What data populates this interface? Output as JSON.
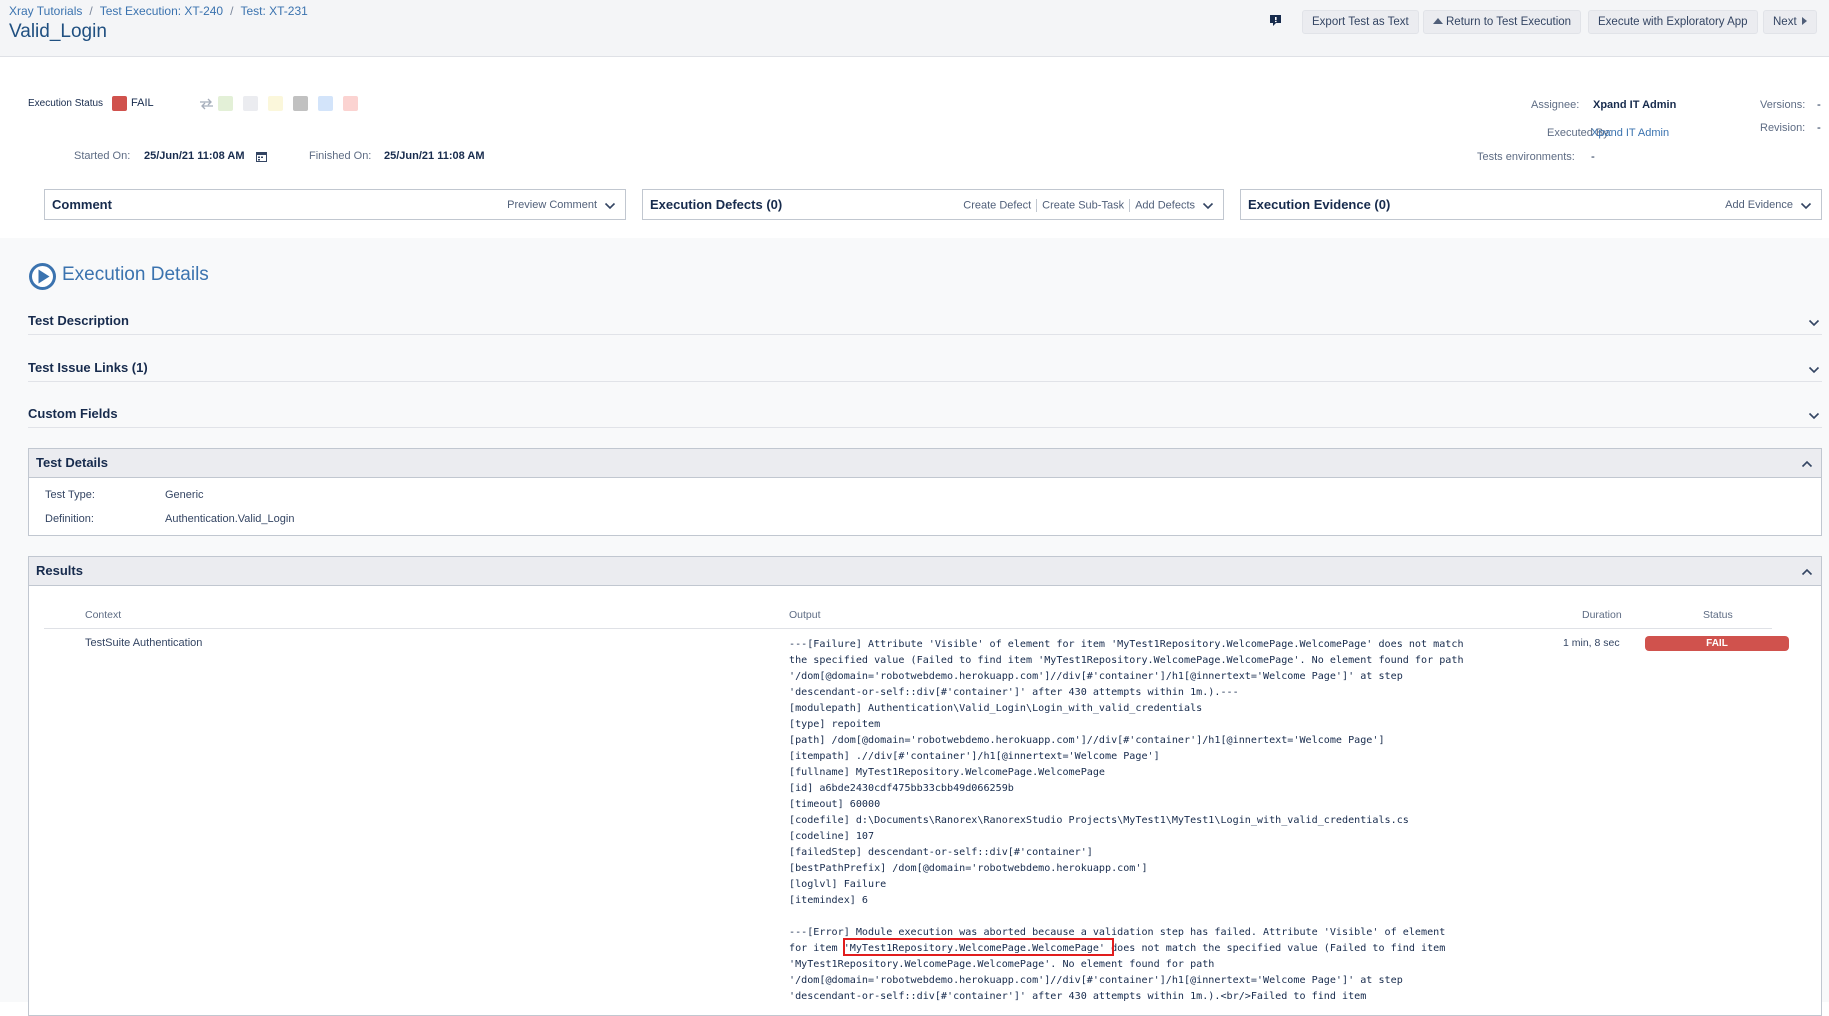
{
  "breadcrumbs": [
    "Xray Tutorials",
    "Test Execution: XT-240",
    "Test: XT-231"
  ],
  "page_title": "Valid_Login",
  "toolbar": {
    "feedback_icon": "feedback-icon",
    "export_label": "Export Test as Text",
    "return_label": "Return to Test Execution",
    "exploratory_label": "Execute with Exploratory App",
    "next_label": "Next"
  },
  "status": {
    "label": "Execution Status",
    "value": "FAIL",
    "color": "#d0524d",
    "swatch_colors": [
      "#e3f0d7",
      "#ebecf0",
      "#fbf7db",
      "#c1c1c1",
      "#d3e4fa",
      "#fbd3d1"
    ]
  },
  "dates": {
    "started_label": "Started On:",
    "started_value": "25/Jun/21 11:08 AM",
    "finished_label": "Finished On:",
    "finished_value": "25/Jun/21 11:08 AM"
  },
  "people": {
    "assignee_label": "Assignee:",
    "assignee_value": "Xpand IT Admin",
    "executed_label": "Executed By:",
    "executed_value": "Xpand IT Admin",
    "envs_label": "Tests environments:",
    "envs_value": "-",
    "versions_label": "Versions:",
    "versions_value": "-",
    "revision_label": "Revision:",
    "revision_value": "-"
  },
  "panels": {
    "comment": {
      "title": "Comment",
      "action": "Preview Comment"
    },
    "defects": {
      "title": "Execution Defects (0)",
      "actions": [
        "Create Defect",
        "Create Sub-Task",
        "Add Defects"
      ]
    },
    "evidence": {
      "title": "Execution Evidence (0)",
      "action": "Add Evidence"
    }
  },
  "execution_details": {
    "title": "Execution Details",
    "sections": [
      "Test Description",
      "Test Issue Links (1)",
      "Custom Fields"
    ]
  },
  "test_details": {
    "title": "Test Details",
    "type_label": "Test Type:",
    "type_value": "Generic",
    "definition_label": "Definition:",
    "definition_value": "Authentication.Valid_Login"
  },
  "results": {
    "title": "Results",
    "columns": [
      "Context",
      "Output",
      "Duration",
      "Status"
    ],
    "row": {
      "context": "TestSuite Authentication",
      "duration": "1 min, 8 sec",
      "status": "FAIL",
      "output": "---[Failure] Attribute 'Visible' of element for item 'MyTest1Repository.WelcomePage.WelcomePage' does not match\nthe specified value (Failed to find item 'MyTest1Repository.WelcomePage.WelcomePage'. No element found for path\n'/dom[@domain='robotwebdemo.herokuapp.com']//div[#'container']/h1[@innertext='Welcome Page']' at step\n'descendant-or-self::div[#'container']' after 430 attempts within 1m.).---\n[modulepath] Authentication\\Valid_Login\\Login_with_valid_credentials\n[type] repoitem\n[path] /dom[@domain='robotwebdemo.herokuapp.com']//div[#'container']/h1[@innertext='Welcome Page']\n[itempath] .//div[#'container']/h1[@innertext='Welcome Page']\n[fullname] MyTest1Repository.WelcomePage.WelcomePage\n[id] a6bde2430cdf475bb33cbb49d066259b\n[timeout] 60000\n[codefile] d:\\Documents\\Ranorex\\RanorexStudio Projects\\MyTest1\\MyTest1\\Login_with_valid_credentials.cs\n[codeline] 107\n[failedStep] descendant-or-self::div[#'container']\n[bestPathPrefix] /dom[@domain='robotwebdemo.herokuapp.com']\n[loglvl] Failure\n[itemindex] 6\n\n---[Error] Module execution was aborted because a validation step has failed. Attribute 'Visible' of element\nfor item 'MyTest1Repository.WelcomePage.WelcomePage' does not match the specified value (Failed to find item\n'MyTest1Repository.WelcomePage.WelcomePage'. No element found for path\n'/dom[@domain='robotwebdemo.herokuapp.com']//div[#'container']/h1[@innertext='Welcome Page']' at step\n'descendant-or-self::div[#'container']' after 430 attempts within 1m.).<br/>Failed to find item"
    }
  }
}
